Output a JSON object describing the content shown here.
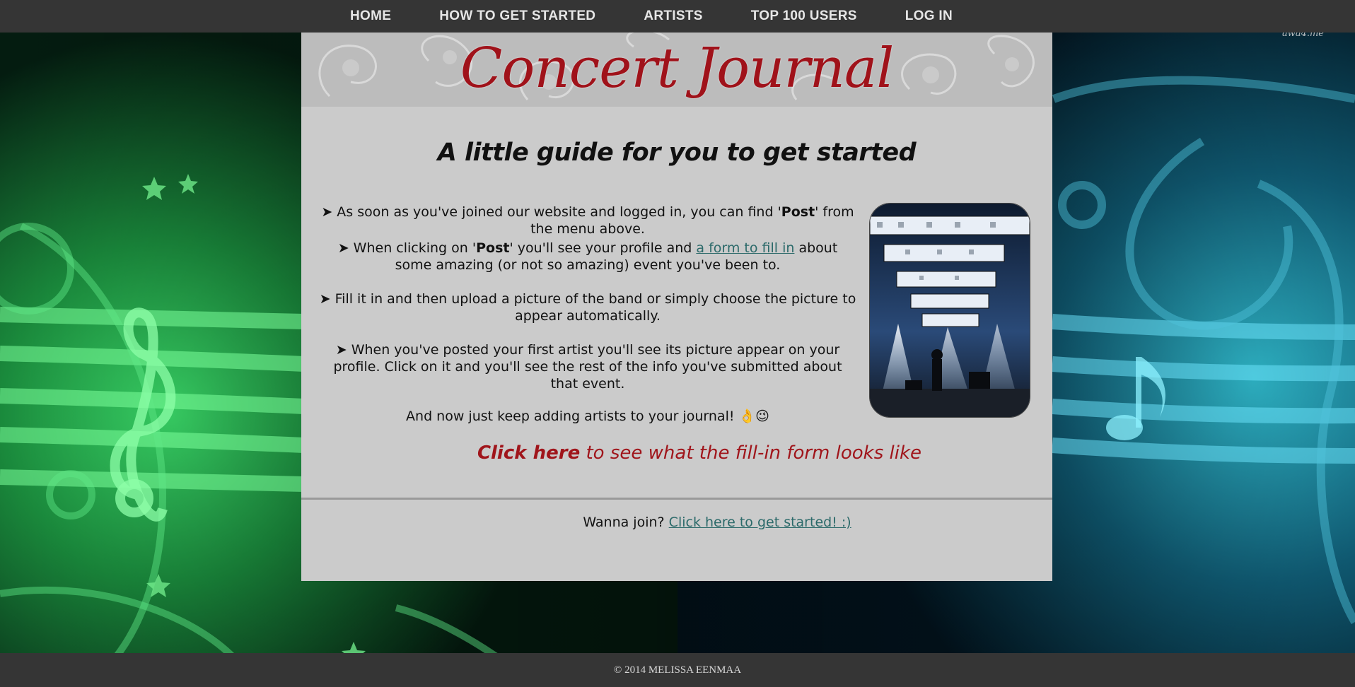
{
  "nav": {
    "items": [
      {
        "label": "HOME"
      },
      {
        "label": "HOW TO GET STARTED"
      },
      {
        "label": "ARTISTS"
      },
      {
        "label": "TOP 100 USERS"
      },
      {
        "label": "LOG IN"
      }
    ]
  },
  "watermark": "uwa4.me",
  "banner": {
    "logo_text": "Concert Journal"
  },
  "guide": {
    "title": "A little guide for you to get started"
  },
  "steps": {
    "step1": {
      "bullet": "➤",
      "before": " As soon as you've joined our website and logged in, you can find '",
      "bold": "Post",
      "after": "' from the menu above."
    },
    "step2": {
      "bullet": "➤",
      "before": " When clicking on '",
      "bold": "Post",
      "middle": "' you'll see your profile and ",
      "link": "a form to fill in",
      "after": " about some amazing (or not so amazing) event you've been to."
    },
    "step3": {
      "bullet": "➤",
      "text": " Fill it in and then upload a picture of the band or simply choose the picture to appear automatically."
    },
    "step4": {
      "bullet": "➤",
      "text": " When you've posted your first artist you'll see its picture appear on your profile. Click on it and you'll see the rest of the info you've submitted about that event."
    },
    "closing": "And now just keep adding artists to your journal! 👌😉"
  },
  "cta": {
    "strong": "Click here",
    "rest": " to see what the fill-in form looks like"
  },
  "join": {
    "prompt": "Wanna join? ",
    "link": "Click here to get started! :)"
  },
  "footer": {
    "text": "© 2014 MELISSA EENMAA"
  },
  "colors": {
    "nav_bg": "#353535",
    "panel_bg": "#cbcbcb",
    "accent_red": "#a0121a",
    "link_teal": "#2c6a6a",
    "left_glow": "#48d86a",
    "right_glow": "#38b8cc"
  }
}
